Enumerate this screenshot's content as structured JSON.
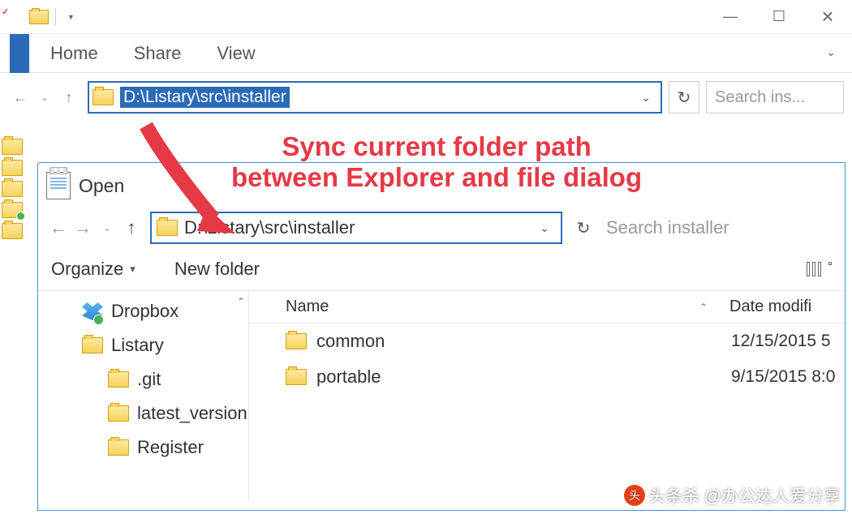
{
  "ribbon_tabs": {
    "home": "Home",
    "share": "Share",
    "view": "View"
  },
  "explorer": {
    "path": "D:\\Listary\\src\\installer",
    "search_placeholder": "Search ins..."
  },
  "annotation": {
    "line1": "Sync current folder path",
    "line2": "between Explorer and file dialog"
  },
  "dialog": {
    "title": "Open",
    "path": "D:\\Listary\\src\\installer",
    "search_placeholder": "Search installer",
    "organize": "Organize",
    "new_folder": "New folder",
    "columns": {
      "name": "Name",
      "date": "Date modifi"
    },
    "tree": [
      {
        "label": "Dropbox",
        "icon": "dropbox"
      },
      {
        "label": "Listary",
        "icon": "folder"
      },
      {
        "label": ".git",
        "icon": "folder",
        "nested": true
      },
      {
        "label": "latest_version",
        "icon": "folder",
        "nested": true
      },
      {
        "label": "Register",
        "icon": "folder",
        "nested": true
      }
    ],
    "files": [
      {
        "name": "common",
        "date": "12/15/2015 5"
      },
      {
        "name": "portable",
        "date": "9/15/2015 8:0"
      }
    ]
  },
  "watermark": "头条杀 @办公达人爱分享"
}
